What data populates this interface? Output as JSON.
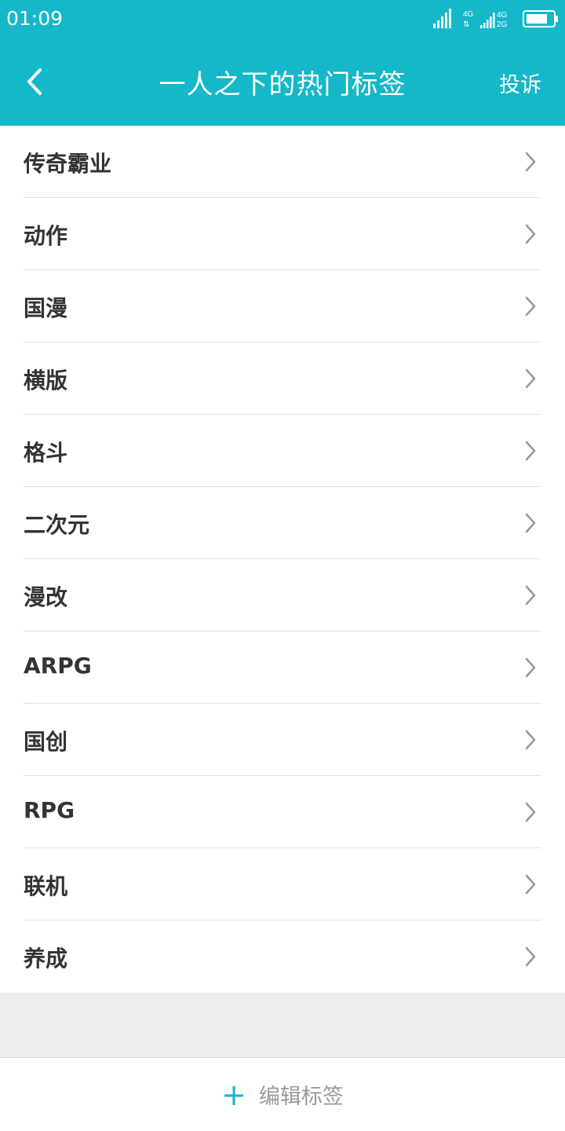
{
  "status_bar": {
    "time": "01:09",
    "network_1": "4G",
    "network_2": "4G",
    "network_3": "2G"
  },
  "header": {
    "title": "一人之下的热门标签",
    "complain_label": "投诉",
    "back_icon": "chevron-left-icon",
    "background_color": "#14b8c8"
  },
  "tags": [
    {
      "label": "传奇霸业"
    },
    {
      "label": "动作"
    },
    {
      "label": "国漫"
    },
    {
      "label": "横版"
    },
    {
      "label": "格斗"
    },
    {
      "label": "二次元"
    },
    {
      "label": "漫改"
    },
    {
      "label": "ARPG"
    },
    {
      "label": "国创"
    },
    {
      "label": "RPG"
    },
    {
      "label": "联机"
    },
    {
      "label": "养成"
    }
  ],
  "footer": {
    "plus_icon": "+",
    "edit_label": "编辑标签"
  }
}
